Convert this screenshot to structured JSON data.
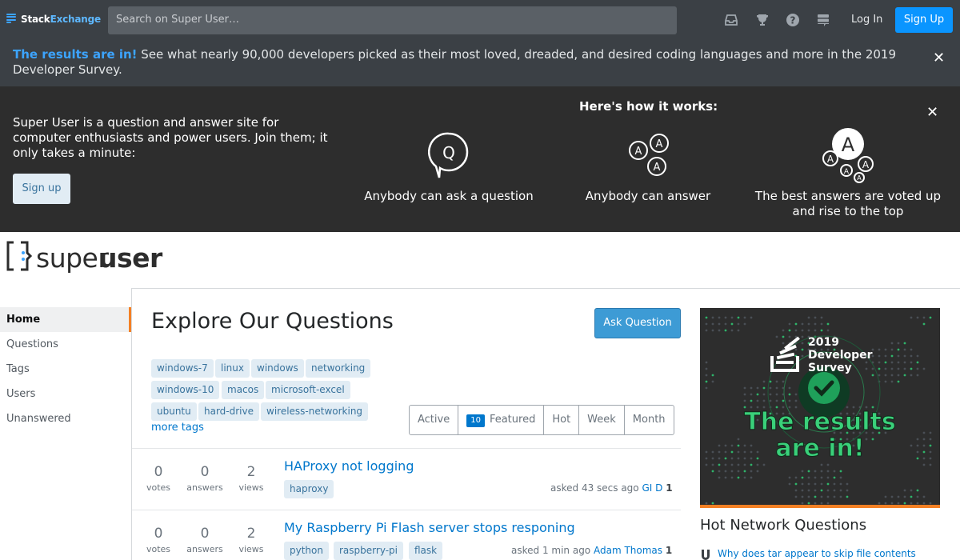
{
  "topbar": {
    "brand_a": "Stack",
    "brand_b": "Exchange",
    "search_placeholder": "Search on Super User…",
    "login": "Log In",
    "signup": "Sign Up"
  },
  "survey": {
    "highlight": "The results are in!",
    "text": " See what nearly 90,000 developers picked as their most loved, dreaded, and desired coding languages and more in the 2019 Developer Survey."
  },
  "hero": {
    "text": "Super User is a question and answer site for computer enthusiasts and power users. Join them; it only takes a minute:",
    "signup": "Sign up",
    "how": "Here's how it works:",
    "col1": "Anybody can ask a question",
    "col2": "Anybody can answer",
    "col3": "The best answers are voted up and rise to the top",
    "q_glyph": "Q",
    "a_glyph": "A"
  },
  "logo": {
    "a": "super",
    "b": "user"
  },
  "nav": {
    "items": [
      "Home",
      "Questions",
      "Tags",
      "Users",
      "Unanswered"
    ]
  },
  "main": {
    "title": "Explore Our Questions",
    "ask": "Ask Question",
    "more_tags": "more tags",
    "tags": [
      "windows-7",
      "linux",
      "windows",
      "networking",
      "windows-10",
      "macos",
      "microsoft-excel",
      "ubuntu",
      "hard-drive",
      "wireless-networking"
    ],
    "tabs": {
      "active": "Active",
      "featured_count": "10",
      "featured": "Featured",
      "hot": "Hot",
      "week": "Week",
      "month": "Month"
    },
    "questions": [
      {
        "votes": "0",
        "votes_l": "votes",
        "answers": "0",
        "answers_l": "answers",
        "views": "2",
        "views_l": "views",
        "title": "HAProxy not logging",
        "tags": [
          "haproxy"
        ],
        "asked": "asked 43 secs ago",
        "user": "GI D",
        "rep": "1"
      },
      {
        "votes": "0",
        "votes_l": "votes",
        "answers": "0",
        "answers_l": "answers",
        "views": "2",
        "views_l": "views",
        "title": "My Raspberry Pi Flash server stops responing",
        "tags": [
          "python",
          "raspberry-pi",
          "flask"
        ],
        "asked": "asked 1 min ago",
        "user": "Adam Thomas",
        "rep": "1"
      }
    ]
  },
  "sidebar": {
    "banner_line1": "2019",
    "banner_line2": "Developer",
    "banner_line3": "Survey",
    "banner_headline1": "The results",
    "banner_headline2": "are in!",
    "hot_title": "Hot Network Questions",
    "hot_link": "Why does tar appear to skip file contents"
  }
}
